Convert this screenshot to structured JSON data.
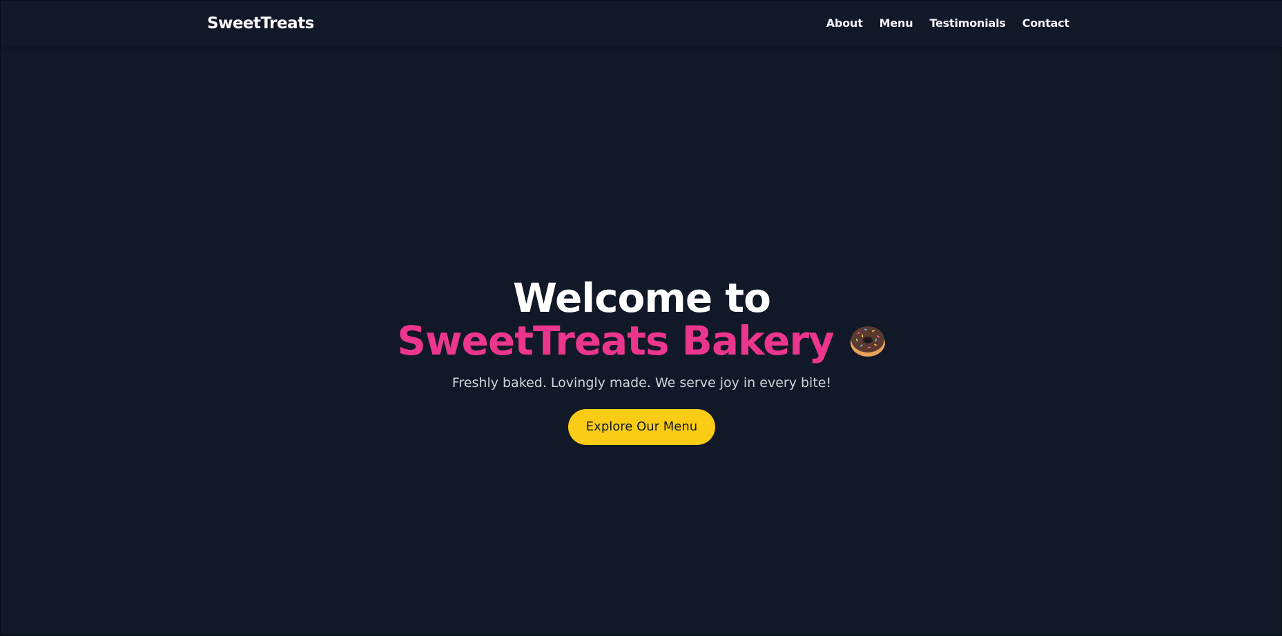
{
  "navbar": {
    "brand": "SweetTreats",
    "links": [
      {
        "label": "About"
      },
      {
        "label": "Menu"
      },
      {
        "label": "Testimonials"
      },
      {
        "label": "Contact"
      }
    ]
  },
  "hero": {
    "title_prefix": "Welcome to ",
    "title_accent": "SweetTreats Bakery",
    "title_icon": "donut-icon",
    "subtitle": "Freshly baked. Lovingly made. We serve joy in every bite!",
    "cta_label": "Explore Our Menu"
  },
  "colors": {
    "background": "#111827",
    "accent": "#ec368d",
    "cta": "#facc15",
    "text": "#ffffff",
    "subtext": "#d1d5db"
  }
}
